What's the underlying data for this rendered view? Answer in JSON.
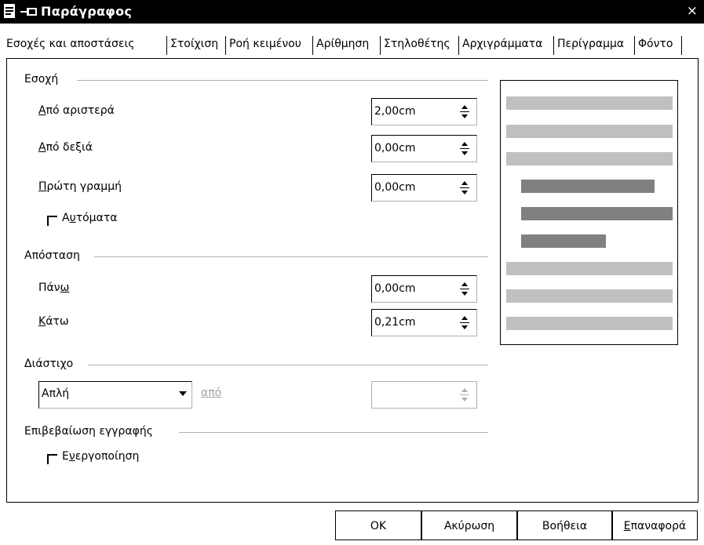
{
  "window": {
    "title": "Παράγραφος",
    "close_glyph": "×"
  },
  "tabs": [
    {
      "label": "Εσοχές και αποστάσεις"
    },
    {
      "label": "Στοίχιση"
    },
    {
      "label": "Ροή κειμένου"
    },
    {
      "label": "Αρίθμηση"
    },
    {
      "label": "Στηλοθέτης"
    },
    {
      "label": "Αρχιγράμματα"
    },
    {
      "label": "Περίγραμμα"
    },
    {
      "label": "Φόντο"
    }
  ],
  "indent": {
    "title": "Εσοχή",
    "from_left": {
      "mnemonic": "Α",
      "label_rest": "πό αριστερά",
      "value": "2,00cm"
    },
    "from_right": {
      "mnemonic": "Α",
      "label_rest": "πό δεξιά",
      "value": "0,00cm"
    },
    "first_line": {
      "mnemonic": "Π",
      "label_rest": "ρώτη γραμμή",
      "value": "0,00cm"
    },
    "automatic": {
      "pre": "Α",
      "mnemonic": "υ",
      "post": "τόματα",
      "checked": false
    }
  },
  "spacing": {
    "title": "Απόσταση",
    "above": {
      "pre": "Πάν",
      "mnemonic": "ω",
      "post": "",
      "value": "0,00cm"
    },
    "below": {
      "pre": "",
      "mnemonic": "Κ",
      "post": "άτω",
      "value": "0,21cm"
    }
  },
  "line_spacing": {
    "title": "Διάστιχο",
    "selected": "Απλή",
    "of_label": "από",
    "of_value": ""
  },
  "register_true": {
    "title": "Επιβεβαίωση εγγραφής",
    "activate": {
      "pre": "Ε",
      "mnemonic": "ν",
      "post": "εργοποίηση",
      "checked": false
    }
  },
  "buttons": {
    "ok": "OK",
    "cancel": "Ακύρωση",
    "help": "Βοήθεια",
    "reset": {
      "mnemonic": "Ε",
      "rest": "παναφορά"
    }
  },
  "colors": {
    "preview_light": "#c0c0c0",
    "preview_dark": "#808080",
    "disabled_text": "#a0a0a0"
  }
}
